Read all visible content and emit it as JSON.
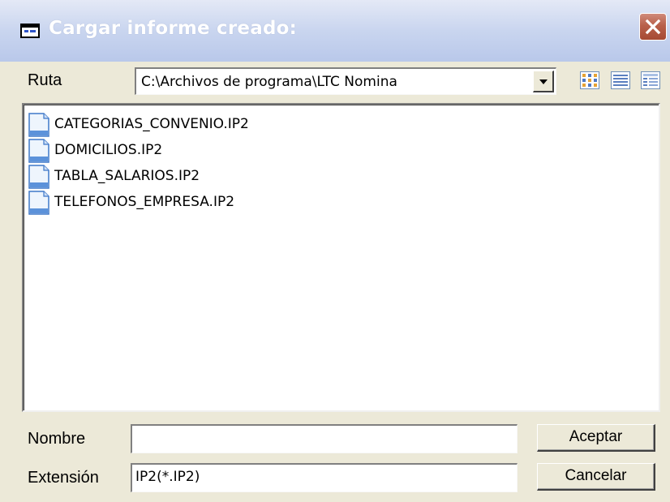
{
  "window": {
    "title": "Cargar informe creado:",
    "icon": "dialog-folder-icon",
    "close_icon": "close-icon"
  },
  "ruta": {
    "label": "Ruta",
    "value": "C:\\Archivos de programa\\LTC Nomina",
    "view_buttons": [
      "large-icons-view-icon",
      "list-view-icon",
      "details-view-icon"
    ]
  },
  "files": [
    {
      "name": "CATEGORIAS_CONVENIO.IP2",
      "icon": "document-icon"
    },
    {
      "name": "DOMICILIOS.IP2",
      "icon": "document-icon"
    },
    {
      "name": "TABLA_SALARIOS.IP2",
      "icon": "document-icon"
    },
    {
      "name": "TELEFONOS_EMPRESA.IP2",
      "icon": "document-icon"
    }
  ],
  "nombre": {
    "label": "Nombre",
    "value": ""
  },
  "extension": {
    "label": "Extensión",
    "value": "IP2(*.IP2)"
  },
  "buttons": {
    "accept": "Aceptar",
    "cancel": "Cancelar"
  },
  "colors": {
    "title_gradient_start": "#e4e9f6",
    "title_gradient_end": "#b9c8ea",
    "dialog_face": "#ece9d8",
    "close_button": "#b8604a"
  }
}
